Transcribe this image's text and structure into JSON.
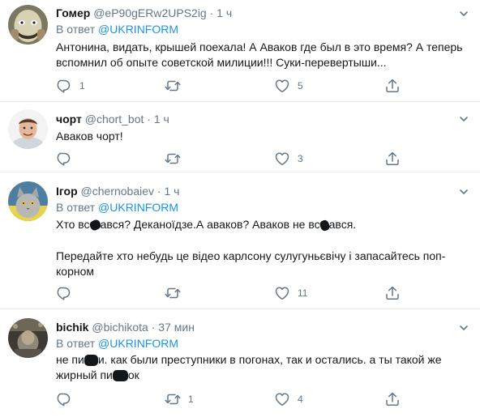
{
  "tweets": [
    {
      "name": "Гомер",
      "handle": "@eP90gERw2UPS2ig",
      "dot": "·",
      "time": "1 ч",
      "reply_prefix": "В ответ",
      "reply_to": "@UKRINFORM",
      "text": "Антонина, видать, крышей поехала! А Аваков где был в это время? А теперь вспомнил об опыте советской милиции!!! Суки-перевертыши...",
      "replies": "1",
      "retweets": "",
      "likes": "5"
    },
    {
      "name": "чорт",
      "handle": "@chort_bot",
      "dot": "·",
      "time": "1 ч",
      "text": "Аваков чорт!",
      "replies": "",
      "retweets": "",
      "likes": "3"
    },
    {
      "name": "Ігор",
      "handle": "@chernobaiev",
      "dot": "·",
      "time": "1 ч",
      "reply_prefix": "В ответ",
      "reply_to": "@UKRINFORM",
      "text_line1_a": "Хто вс",
      "text_line1_b": "ався? Деканоїдзе.А аваков? Аваков не вс",
      "text_line1_c": "ався.",
      "text_para2": "Передайте хто небудь це відео карлсону сулугуньєвічу і запасайтесь поп-корном",
      "replies": "",
      "retweets": "",
      "likes": "11"
    },
    {
      "name": "bichik",
      "handle": "@bichikota",
      "dot": "·",
      "time": "37 мин",
      "reply_prefix": "В ответ",
      "reply_to": "@UKRINFORM",
      "text_a": "не пи",
      "text_b": "и. как были преступники в погонах, так и остались. а ты такой же жирный пи",
      "text_c": "ок",
      "replies": "",
      "retweets": "1",
      "likes": "4"
    }
  ],
  "colors": {
    "text": "#14171a",
    "secondary": "#657786",
    "link": "#1b95e0",
    "divider": "#e6ecf0"
  },
  "icons": [
    "reply-icon",
    "retweet-icon",
    "like-icon",
    "share-icon",
    "caret-down-icon"
  ]
}
